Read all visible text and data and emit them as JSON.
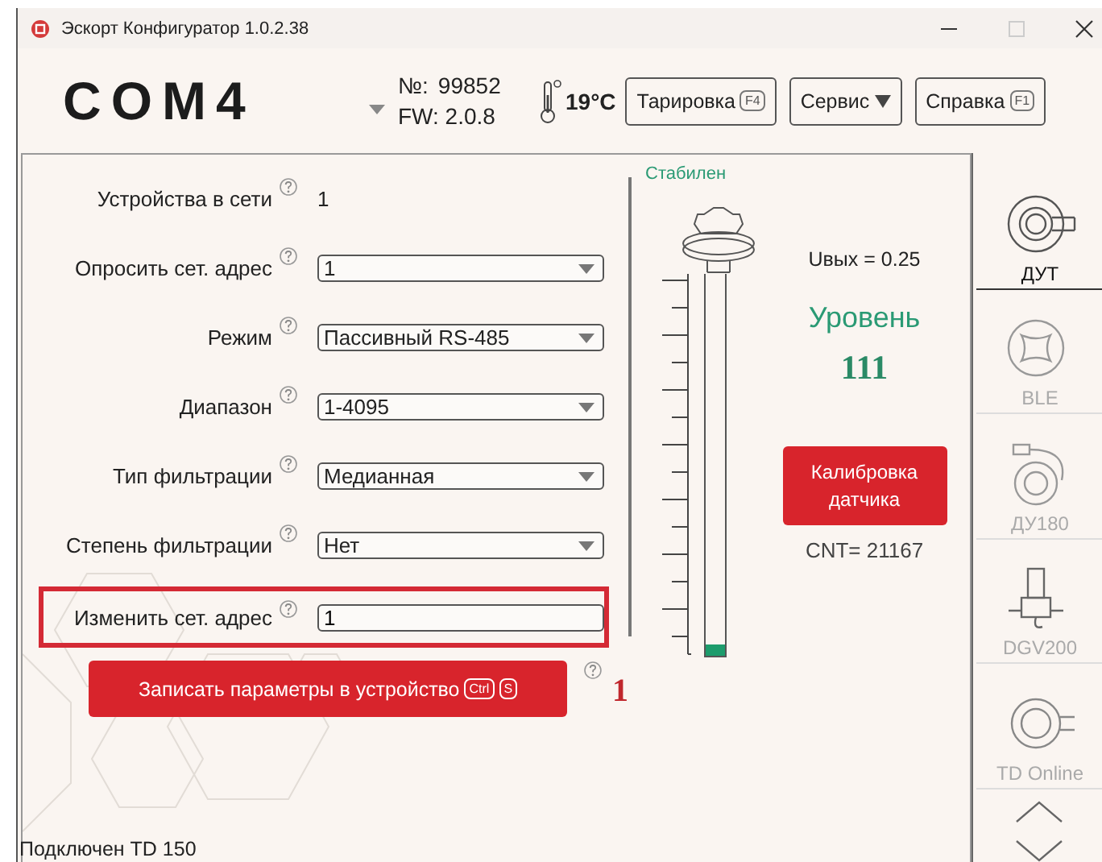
{
  "window": {
    "title": "Эскорт Конфигуратор 1.0.2.38"
  },
  "header": {
    "port": "COM4",
    "serial_label": "№:",
    "serial": "99852",
    "fw": "FW: 2.0.8",
    "temperature": "19°C",
    "buttons": [
      {
        "label": "Тарировка",
        "kind": "hotkey",
        "hotkey": "F4"
      },
      {
        "label": "Сервис",
        "kind": "menu"
      },
      {
        "label": "Справка",
        "kind": "hotkey",
        "hotkey": "F1"
      }
    ]
  },
  "form": {
    "rows": [
      {
        "label": "Устройства в сети",
        "kind": "text",
        "value": "1",
        "highlighted": false
      },
      {
        "label": "Опросить сет. адрес",
        "kind": "select",
        "value": "1",
        "highlighted": false
      },
      {
        "label": "Режим",
        "kind": "select",
        "value": "Пассивный RS-485",
        "highlighted": false
      },
      {
        "label": "Диапазон",
        "kind": "select",
        "value": "1-4095",
        "highlighted": false
      },
      {
        "label": "Тип фильтрации",
        "kind": "select",
        "value": "Медианная",
        "highlighted": false
      },
      {
        "label": "Степень фильтрации",
        "kind": "select",
        "value": "Нет",
        "highlighted": false
      },
      {
        "label": "Изменить сет. адрес",
        "kind": "input",
        "value": "1",
        "highlighted": true
      }
    ],
    "write_button": {
      "label": "Записать параметры в устройство",
      "hotkeys": [
        "Ctrl",
        "S"
      ]
    },
    "annotation": "1",
    "status": "Подключен TD 150"
  },
  "gauge": {
    "status": "Стабилен",
    "level": 0.03,
    "voltage": "Uвых = 0.25",
    "level_title": "Уровень",
    "level_value": "111",
    "calibrate_button": "Калибровка датчика",
    "cnt": "CNT= 21167"
  },
  "sidebar": {
    "items": [
      {
        "label": "ДУТ",
        "selected": true
      },
      {
        "label": "BLE",
        "selected": false
      },
      {
        "label": "ДУ180",
        "selected": false
      },
      {
        "label": "DGV200",
        "selected": false
      },
      {
        "label": "TD Online",
        "selected": false
      }
    ]
  }
}
